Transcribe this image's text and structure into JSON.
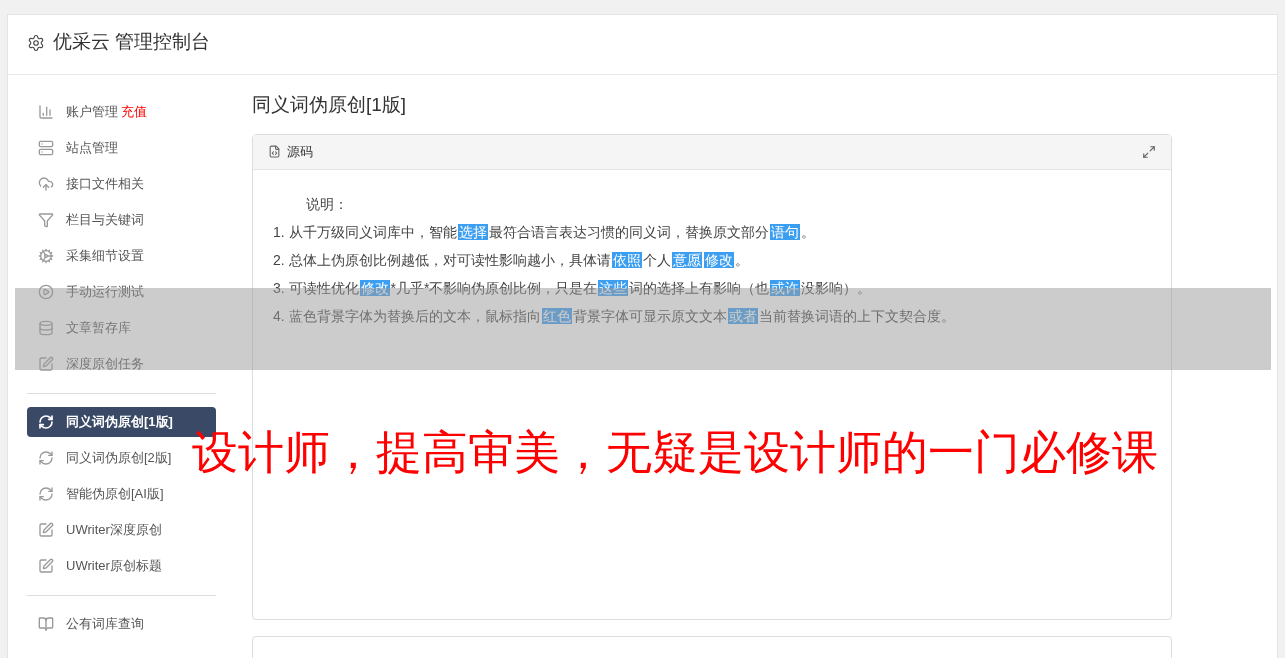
{
  "header": {
    "title": "优采云 管理控制台"
  },
  "sidebar": {
    "groups": [
      {
        "items": [
          {
            "label": "账户管理",
            "badge": "充值",
            "kind": "chart",
            "selected": false
          },
          {
            "label": "站点管理",
            "kind": "server",
            "selected": false
          },
          {
            "label": "接口文件相关",
            "kind": "cloud",
            "selected": false
          },
          {
            "label": "栏目与关键词",
            "kind": "filter",
            "selected": false
          },
          {
            "label": "采集细节设置",
            "kind": "cogs",
            "selected": false
          },
          {
            "label": "手动运行测试",
            "kind": "play",
            "selected": false
          },
          {
            "label": "文章暂存库",
            "kind": "database",
            "selected": false
          },
          {
            "label": "深度原创任务",
            "kind": "edit",
            "selected": false
          }
        ]
      },
      {
        "items": [
          {
            "label": "同义词伪原创[1版]",
            "kind": "refresh",
            "selected": true
          },
          {
            "label": "同义词伪原创[2版]",
            "kind": "refresh",
            "selected": false
          },
          {
            "label": "智能伪原创[AI版]",
            "kind": "refresh",
            "selected": false
          },
          {
            "label": "UWriter深度原创",
            "kind": "edit",
            "selected": false
          },
          {
            "label": "UWriter原创标题",
            "kind": "edit",
            "selected": false
          }
        ]
      },
      {
        "items": [
          {
            "label": "公有词库查询",
            "kind": "book",
            "selected": false
          }
        ]
      }
    ]
  },
  "content": {
    "title": "同义词伪原创[1版]",
    "panel": {
      "title": "源码",
      "heading": "说明：",
      "lines": [
        [
          {
            "text": "1. 从千万级同义词库中，智能",
            "highlighted": false
          },
          {
            "text": "选择",
            "highlighted": true
          },
          {
            "text": "最符合语言表达习惯的同义词，替换原文部分",
            "highlighted": false
          },
          {
            "text": "语句",
            "highlighted": true
          },
          {
            "text": "。",
            "highlighted": false
          }
        ],
        [
          {
            "text": "2. 总体上伪原创比例越低，对可读性影响越小，具体请",
            "highlighted": false
          },
          {
            "text": "依照",
            "highlighted": true
          },
          {
            "text": "个人",
            "highlighted": false
          },
          {
            "text": "意愿",
            "highlighted": true
          },
          {
            "text": "修改",
            "highlighted": true
          },
          {
            "text": "。",
            "highlighted": false
          }
        ],
        [
          {
            "text": "3. 可读性优化",
            "highlighted": false
          },
          {
            "text": "修改",
            "highlighted": true
          },
          {
            "text": "*几乎*不影响伪原创比例，只是在",
            "highlighted": false
          },
          {
            "text": "这些",
            "highlighted": true
          },
          {
            "text": "词的选择上有影响（也",
            "highlighted": false
          },
          {
            "text": "或许",
            "highlighted": true
          },
          {
            "text": "没影响）。",
            "highlighted": false
          }
        ],
        [
          {
            "text": "4. 蓝色背景字体为替换后的文本，鼠标指向",
            "highlighted": false
          },
          {
            "text": "红色",
            "highlighted": true
          },
          {
            "text": "背景字体可显示原文文本",
            "highlighted": false
          },
          {
            "text": "或者",
            "highlighted": true
          },
          {
            "text": "当前替换词语的上下文契合度。",
            "highlighted": false
          }
        ]
      ]
    }
  },
  "overlay": {
    "text": "设计师，提高审美，无疑是设计师的一门必修课"
  }
}
